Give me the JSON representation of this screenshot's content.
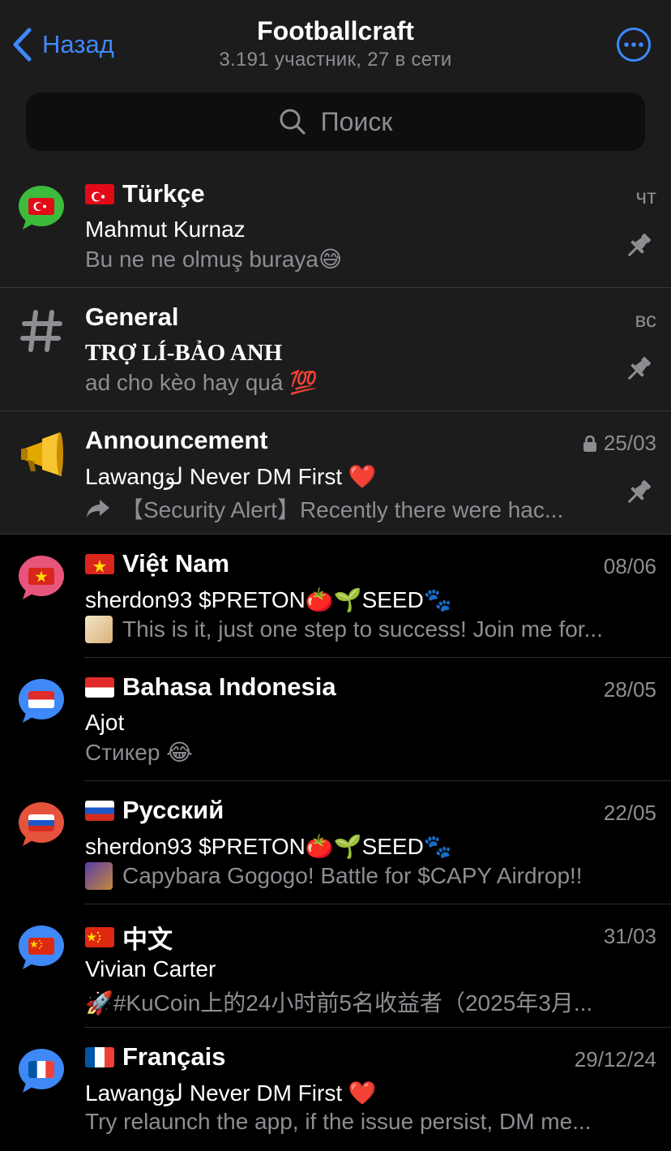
{
  "header": {
    "back_label": "Назад",
    "title": "Footballcraft",
    "subtitle": "3.191 участник, 27 в сети",
    "more_icon": "ellipsis-circle-icon"
  },
  "search": {
    "placeholder": "Поиск"
  },
  "accent_color": "#3e88f7",
  "topics": [
    {
      "name": "Türkçe",
      "sender": "Mahmut Kurnaz",
      "message": "Bu ne ne olmuş buraya😅",
      "date": "чт",
      "pinned": true,
      "icon": "turkey-flag-bubble-icon"
    },
    {
      "name": "General",
      "sender": "TRỢ LÍ-BẢO ANH",
      "message": "ad cho kèo hay quá 💯",
      "date": "вс",
      "pinned": true,
      "icon": "hash-icon"
    },
    {
      "name": "Announcement",
      "sender": "Lawangلوٓ Never DM First ❤️",
      "message": "【Security Alert】Recently there were hac...",
      "date": "25/03",
      "pinned": true,
      "icon": "megaphone-icon"
    },
    {
      "name": "Việt Nam",
      "sender": "sherdon93 $PRETON🍅🌱SEED🐾",
      "message": "This is it, just one step to success! Join me for...",
      "date": "08/06",
      "pinned": false,
      "icon": "vietnam-flag-bubble-icon"
    },
    {
      "name": "Bahasa Indonesia",
      "sender": "Ajot",
      "message": "Стикер 😂",
      "date": "28/05",
      "pinned": false,
      "icon": "indonesia-flag-bubble-icon"
    },
    {
      "name": "Русский",
      "sender": "sherdon93 $PRETON🍅🌱SEED🐾",
      "message": "Capybara Gogogo! Battle for $CAPY Airdrop!!",
      "date": "22/05",
      "pinned": false,
      "icon": "russia-flag-bubble-icon"
    },
    {
      "name": "中文",
      "sender": "Vivian Carter",
      "message": "🚀#KuCoin上的24小时前5名收益者（2025年3月...",
      "date": "31/03",
      "pinned": false,
      "icon": "china-flag-bubble-icon"
    },
    {
      "name": "Français",
      "sender": "Lawangلوٓ Never DM First ❤️",
      "message": "Try relaunch the app, if the issue persist, DM me...",
      "date": "29/12/24",
      "pinned": false,
      "icon": "france-flag-bubble-icon"
    }
  ]
}
